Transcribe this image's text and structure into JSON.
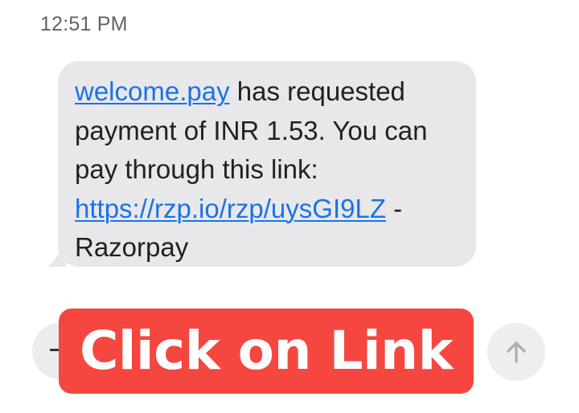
{
  "header": {
    "time": "12:51 PM"
  },
  "message": {
    "sender_link": "welcome.pay",
    "line1_rest": " has requested payment of INR 1.53. You can pay through this link: ",
    "payment_link": "https://rzp.io/rzp/uysGI9LZ",
    "suffix": " - Razorpay"
  },
  "overlay": {
    "cta_label": "Click on Link"
  },
  "composer": {
    "send_icon": "arrow-up-icon"
  },
  "colors": {
    "link": "#1a73e8",
    "bubble": "#e8e8ea",
    "cta_background": "#f64640"
  }
}
